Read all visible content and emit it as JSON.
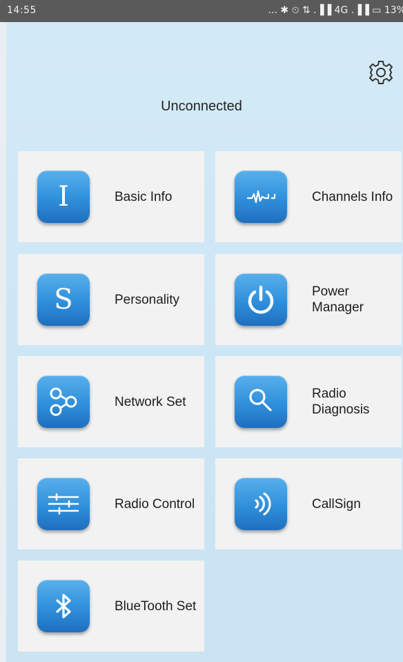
{
  "status_bar": {
    "time": "14:55",
    "icons": "... ✱ ⏲ ⇅ .▐▐ 4G .▐▐ ▭ 13%"
  },
  "connection_status": "Unconnected",
  "tiles": [
    {
      "label": "Basic Info",
      "icon": "basic-info-icon"
    },
    {
      "label": "Channels Info",
      "icon": "channels-info-icon"
    },
    {
      "label": "Personality",
      "icon": "personality-icon"
    },
    {
      "label": "Power Manager",
      "icon": "power-icon"
    },
    {
      "label": "Network Set",
      "icon": "network-icon"
    },
    {
      "label": "Radio Diagnosis",
      "icon": "search-icon"
    },
    {
      "label": "Radio Control",
      "icon": "sliders-icon"
    },
    {
      "label": "CallSign",
      "icon": "callsign-icon"
    },
    {
      "label": "BlueTooth Set",
      "icon": "bluetooth-icon"
    }
  ],
  "icon_glyphs": {
    "basic_info": "I",
    "personality": "S"
  },
  "colors": {
    "background": "#d4eaf7",
    "tile": "#f2f2f2",
    "icon_blue": "#2f8fdb",
    "status_bar": "#5a5a5a"
  }
}
